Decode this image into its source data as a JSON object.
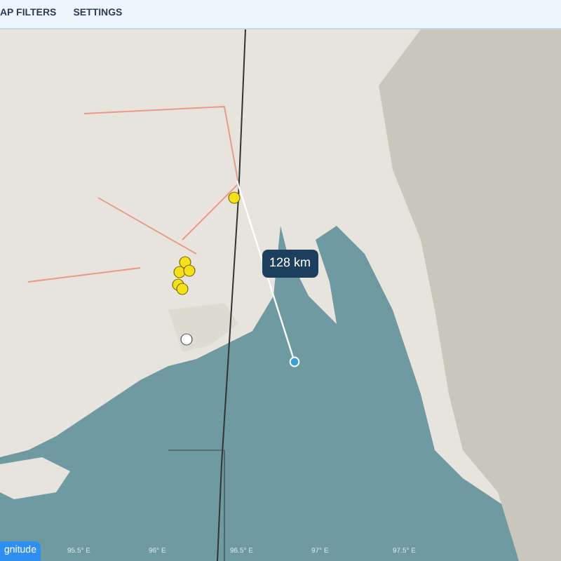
{
  "nav": {
    "items": [
      {
        "label": "AP FILTERS"
      },
      {
        "label": "SETTINGS"
      }
    ]
  },
  "map": {
    "distance_label": "128 km",
    "lon_labels": [
      "95.5° E",
      "96° E",
      "96.5° E",
      "97° E",
      "97.5° E"
    ],
    "magnitude_button": "gnitude"
  }
}
